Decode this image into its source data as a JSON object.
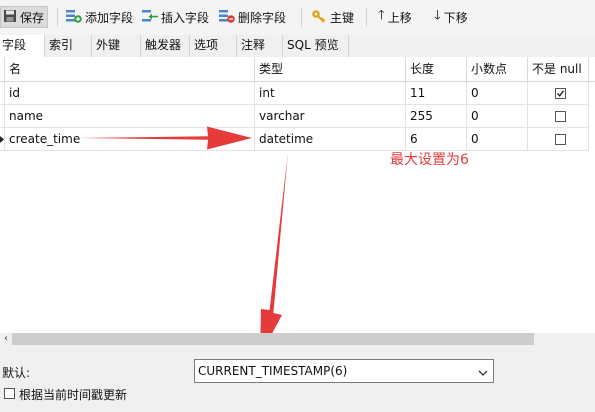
{
  "toolbar": {
    "save": "保存",
    "add_field": "添加字段",
    "insert_field": "插入字段",
    "delete_field": "删除字段",
    "primary_key": "主键",
    "move_up": "上移",
    "move_down": "下移"
  },
  "tabs": [
    "字段",
    "索引",
    "外键",
    "触发器",
    "选项",
    "注释",
    "SQL 预览"
  ],
  "grid": {
    "headers": [
      "名",
      "类型",
      "长度",
      "小数点",
      "不是 null"
    ],
    "rows": [
      {
        "name": "id",
        "type": "int",
        "length": "11",
        "decimals": "0",
        "not_null": true
      },
      {
        "name": "name",
        "type": "varchar",
        "length": "255",
        "decimals": "0",
        "not_null": false
      },
      {
        "name": "create_time",
        "type": "datetime",
        "length": "6",
        "decimals": "0",
        "not_null": false
      }
    ]
  },
  "annotation": {
    "text": "最大设置为6",
    "color": "#e63b3b"
  },
  "properties": {
    "default_label": "默认:",
    "default_value": "CURRENT_TIMESTAMP(6)",
    "on_update_label": "根据当前时间戳更新",
    "on_update_checked": false
  }
}
